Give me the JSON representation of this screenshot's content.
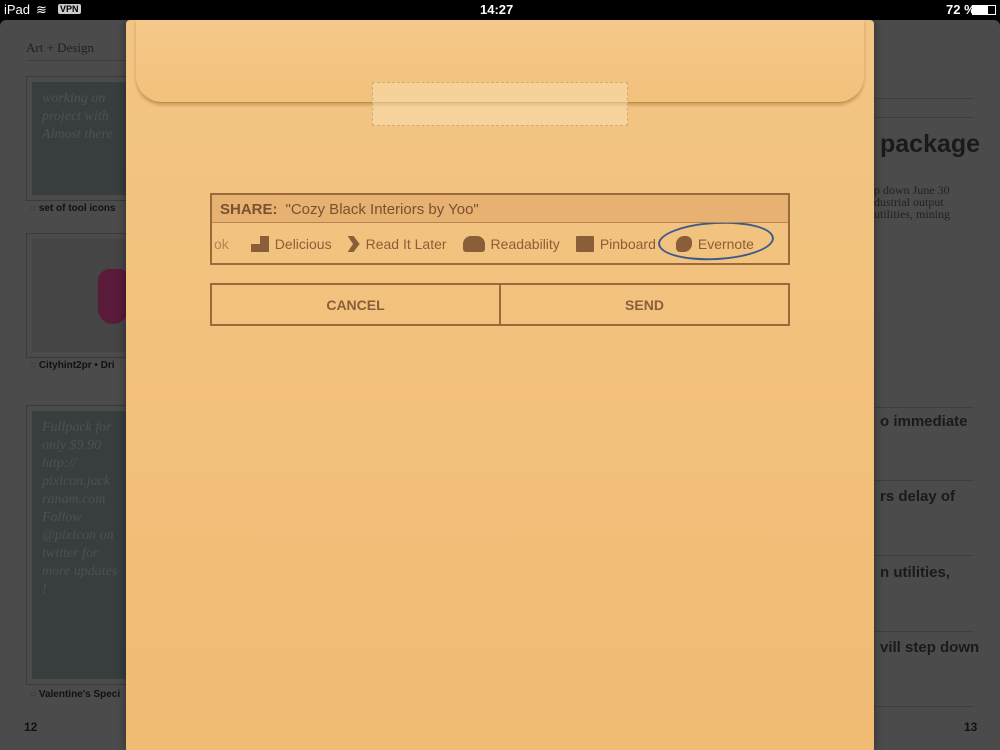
{
  "status": {
    "device": "iPad",
    "vpn": "VPN",
    "time": "14:27",
    "battery": "72 %",
    "battery_level": 0.72
  },
  "left_page": {
    "section": "Art + Design",
    "cards": [
      {
        "text": "working on project with Almost there",
        "caption": "set of tool icons"
      },
      {
        "text": "",
        "caption": "Cityhint2pr • Dri"
      },
      {
        "text": "Fullpack for only $9.90 http:// pixicon.jack ranam.com Follow @pixicon on twitter for more updates !",
        "caption": "Valentine's Speci"
      }
    ],
    "page_number": "12"
  },
  "right_page": {
    "headline": "package",
    "summary": "p down June 30\ndustrial output\nutilities, mining",
    "items": [
      "o immediate",
      "rs delay of",
      "n utilities,",
      "vill step down"
    ],
    "page_number": "13"
  },
  "share": {
    "label": "SHARE:",
    "title": "\"Cozy Black Interiors by Yoo\"",
    "services": [
      {
        "name": "ok",
        "icon": ""
      },
      {
        "name": "Delicious",
        "icon": "delicious-icon"
      },
      {
        "name": "Read It Later",
        "icon": "read-it-later-icon"
      },
      {
        "name": "Readability",
        "icon": "readability-icon"
      },
      {
        "name": "Pinboard",
        "icon": "pinboard-icon"
      },
      {
        "name": "Evernote",
        "icon": "evernote-icon",
        "selected": true
      }
    ],
    "cancel": "CANCEL",
    "send": "SEND"
  },
  "colors": {
    "envelope": "#f2c17c",
    "ink": "#8a5e38",
    "circle": "#3c5a8a"
  }
}
